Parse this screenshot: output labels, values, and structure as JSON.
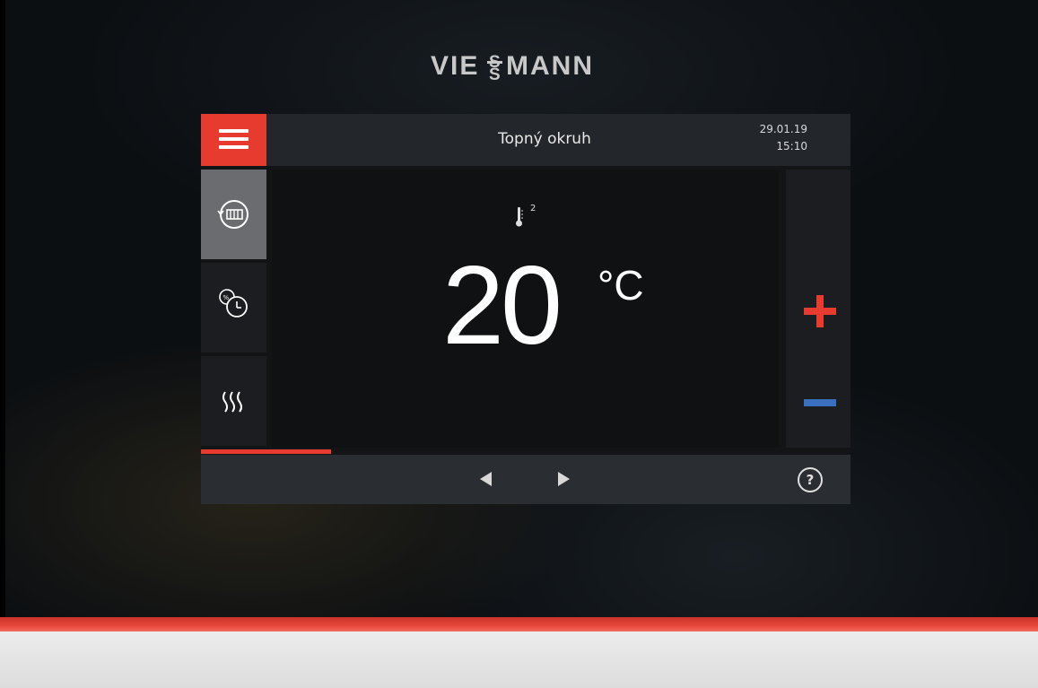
{
  "brand": {
    "logo_text": "VIESSMANN"
  },
  "header": {
    "menu_icon": "hamburger-menu-icon",
    "title": "Topný okruh",
    "date": "29.01.19",
    "time": "15:10"
  },
  "sidebar": {
    "items": [
      {
        "icon": "radiator-circuit-icon",
        "active": true
      },
      {
        "icon": "schedule-clock-icon",
        "active": false
      },
      {
        "icon": "heating-waves-icon",
        "active": false
      }
    ]
  },
  "main": {
    "sensor_icon": "thermometer-icon",
    "sensor_index": "2",
    "temperature": "20",
    "unit": "°C"
  },
  "controls": {
    "increase_icon": "plus-icon",
    "decrease_icon": "minus-icon"
  },
  "pager": {
    "progress": 0.2,
    "prev_icon": "arrow-left-icon",
    "next_icon": "arrow-right-icon"
  },
  "footer": {
    "help_label": "?"
  },
  "colors": {
    "accent_red": "#e63b2e",
    "accent_blue": "#3a6fc0",
    "screen_bg": "#121416",
    "active_tab": "#6a6c70"
  }
}
